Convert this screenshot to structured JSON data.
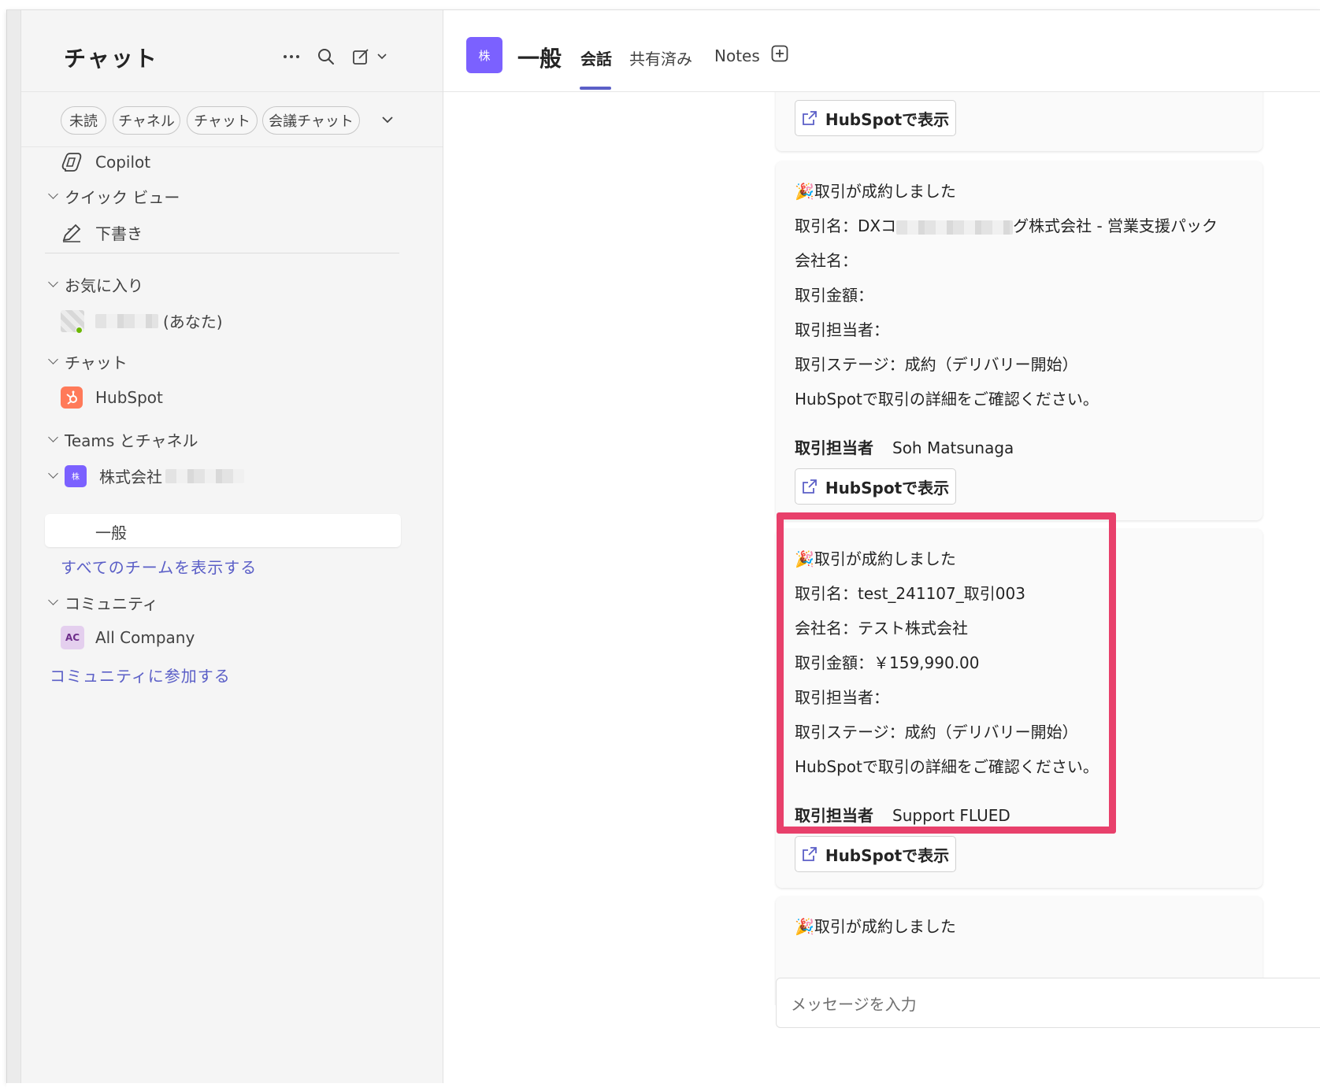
{
  "sidebar": {
    "title": "チャット",
    "filters": [
      "未読",
      "チャネル",
      "チャット",
      "会議チャット"
    ],
    "copilot": "Copilot",
    "quick_view": "クイック ビュー",
    "drafts": "下書き",
    "favorites": "お気に入り",
    "me_suffix": "(あなた)",
    "chats_section": "チャット",
    "hubspot": "HubSpot",
    "teams_section": "Teams とチャネル",
    "team_name": "株式会社",
    "team_avatar": "株",
    "channel_general": "一般",
    "show_all_teams": "すべてのチームを表示する",
    "community_section": "コミュニティ",
    "all_company": "All Company",
    "all_company_initials": "AC",
    "join_community": "コミュニティに参加する"
  },
  "header": {
    "avatar": "株",
    "channel_title": "一般",
    "tabs": [
      "会話",
      "共有済み",
      "Notes"
    ]
  },
  "messages": {
    "hubspot_button": "HubSpotで表示",
    "cards": [
      {
        "headline": "取引が成約しました",
        "deal_name": "取引名：DXコ",
        "deal_name_tail": "グ株式会社 - 営業支援パック",
        "company": "会社名：",
        "amount": "取引金額：",
        "owner_line": "取引担当者：",
        "stage": "取引ステージ：成約（デリバリー開始）",
        "note": "HubSpotで取引の詳細をご確認ください。",
        "owner_label": "取引担当者",
        "owner_value": "Soh Matsunaga"
      },
      {
        "headline": "取引が成約しました",
        "deal_name": "取引名：test_241107_取引003",
        "company": "会社名：テスト株式会社",
        "amount": "取引金額：￥159,990.00",
        "owner_line": "取引担当者：",
        "stage": "取引ステージ：成約（デリバリー開始）",
        "note": "HubSpotで取引の詳細をご確認ください。",
        "owner_label": "取引担当者",
        "owner_value": "Support FLUED"
      },
      {
        "headline": "取引が成約しました"
      }
    ]
  },
  "composer": {
    "placeholder": "メッセージを入力"
  },
  "colors": {
    "accent": "#5b5fc7",
    "team_avatar": "#7b61ff",
    "hubspot": "#ff7a59",
    "highlight": "#e8406b"
  }
}
